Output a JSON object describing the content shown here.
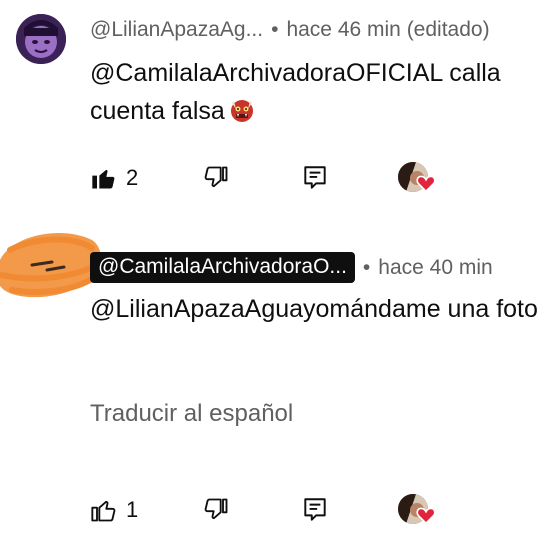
{
  "comments": [
    {
      "author": "@LilianApazaAg...",
      "separator": "•",
      "time": "hace 46 min (editado)",
      "text": "@CamilalaArchivadoraOFICIAL calla cuenta falsa",
      "emoji": "ogre-emoji",
      "likes": "2",
      "liked": true
    },
    {
      "author": "@CamilalaArchivadoraO...",
      "separator": "•",
      "time": "hace 40 min",
      "text": "@LilianApazaAguayomándame una foto",
      "translate": "Traducir al español",
      "likes": "1",
      "liked": false
    }
  ],
  "colors": {
    "text": "#0f0f0f",
    "secondary": "#606060",
    "scribble": "#f39a4a",
    "heart": "#e0243c"
  }
}
